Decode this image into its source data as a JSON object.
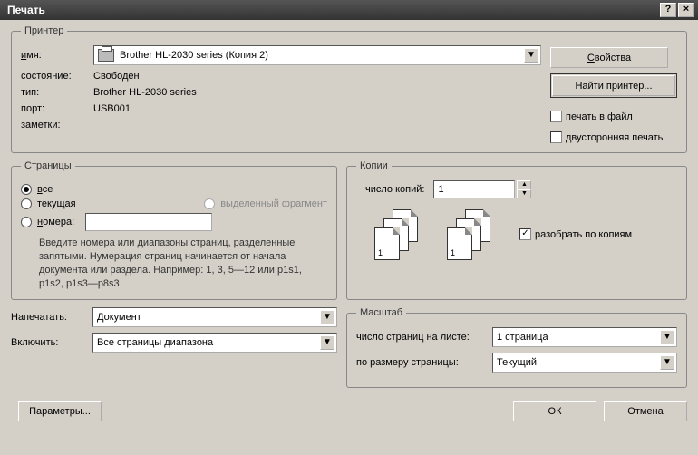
{
  "title": "Печать",
  "printer": {
    "legend": "Принтер",
    "name_label_u": "и",
    "name_label_r": "мя:",
    "name_value": "Brother HL-2030 series (Копия 2)",
    "state_label": "состояние:",
    "state_value": "Свободен",
    "type_label": "тип:",
    "type_value": "Brother HL-2030 series",
    "port_label": "порт:",
    "port_value": "USB001",
    "notes_label": "заметки:",
    "properties_btn_u": "С",
    "properties_btn_r": "войства",
    "find_btn": "Найти принтер...",
    "print_to_file": "печать в файл",
    "duplex": "двусторонняя печать"
  },
  "pages": {
    "legend": "Страницы",
    "all_u": "в",
    "all_r": "се",
    "current_u": "т",
    "current_r": "екущая",
    "selection": "выделенный фрагмент",
    "numbers_u": "н",
    "numbers_r": "омера:",
    "hint": "Введите номера или диапазоны страниц, разделенные запятыми. Нумерация страниц начинается от начала документа или раздела. Например: 1, 3, 5—12 или p1s1, p1s2, p1s3—p8s3"
  },
  "copies": {
    "legend": "Копии",
    "count_label": "число копий:",
    "count_value": "1",
    "collate_label": "разобрать по копиям",
    "collate_checked": "✓"
  },
  "print_what": {
    "label": "Напечатать:",
    "value": "Документ"
  },
  "include": {
    "label": "Включить:",
    "value": "Все страницы диапазона"
  },
  "zoom": {
    "legend": "Масштаб",
    "pages_per_sheet_label": "число страниц на листе:",
    "pages_per_sheet_value": "1 страница",
    "scale_to_label": "по размеру страницы:",
    "scale_to_value": "Текущий"
  },
  "bottom": {
    "params": "Параметры...",
    "ok": "ОК",
    "cancel": "Отмена"
  }
}
